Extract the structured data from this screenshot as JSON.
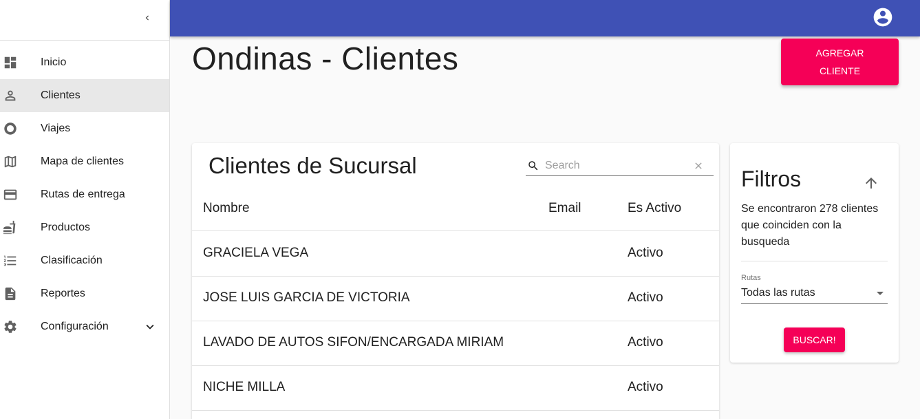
{
  "sidebar": {
    "items": [
      {
        "label": "Inicio",
        "icon": "dashboard-icon"
      },
      {
        "label": "Clientes",
        "icon": "person-icon",
        "active": true
      },
      {
        "label": "Viajes",
        "icon": "circle-icon"
      },
      {
        "label": "Mapa de clientes",
        "icon": "map-icon"
      },
      {
        "label": "Rutas de entrega",
        "icon": "credit-card-icon"
      },
      {
        "label": "Productos",
        "icon": "fastfood-icon"
      },
      {
        "label": "Clasificación",
        "icon": "list-numbered-icon"
      },
      {
        "label": "Reportes",
        "icon": "document-icon"
      },
      {
        "label": "Configuración",
        "icon": "gear-icon",
        "expandable": true
      }
    ]
  },
  "header": {
    "title": "Ondinas - Clientes",
    "add_button_label": "AGREGAR CLIENTE"
  },
  "table": {
    "title": "Clientes de Sucursal",
    "search_placeholder": "Search",
    "columns": [
      "Nombre",
      "Email",
      "Es Activo"
    ],
    "rows": [
      {
        "nombre": "GRACIELA VEGA",
        "email": "",
        "activo": "Activo"
      },
      {
        "nombre": "JOSE LUIS GARCIA DE VICTORIA",
        "email": "",
        "activo": "Activo"
      },
      {
        "nombre": "LAVADO DE AUTOS SIFON/ENCARGADA MIRIAM",
        "email": "",
        "activo": "Activo"
      },
      {
        "nombre": "NICHE MILLA",
        "email": "",
        "activo": "Activo"
      }
    ]
  },
  "filters": {
    "title": "Filtros",
    "count_text": "Se encontraron 278 clientes que coinciden con la busqueda",
    "route_label": "Rutas",
    "route_value": "Todas las rutas",
    "search_button": "BUSCAR!"
  },
  "colors": {
    "primary": "#3f51b5",
    "accent": "#f50057"
  }
}
